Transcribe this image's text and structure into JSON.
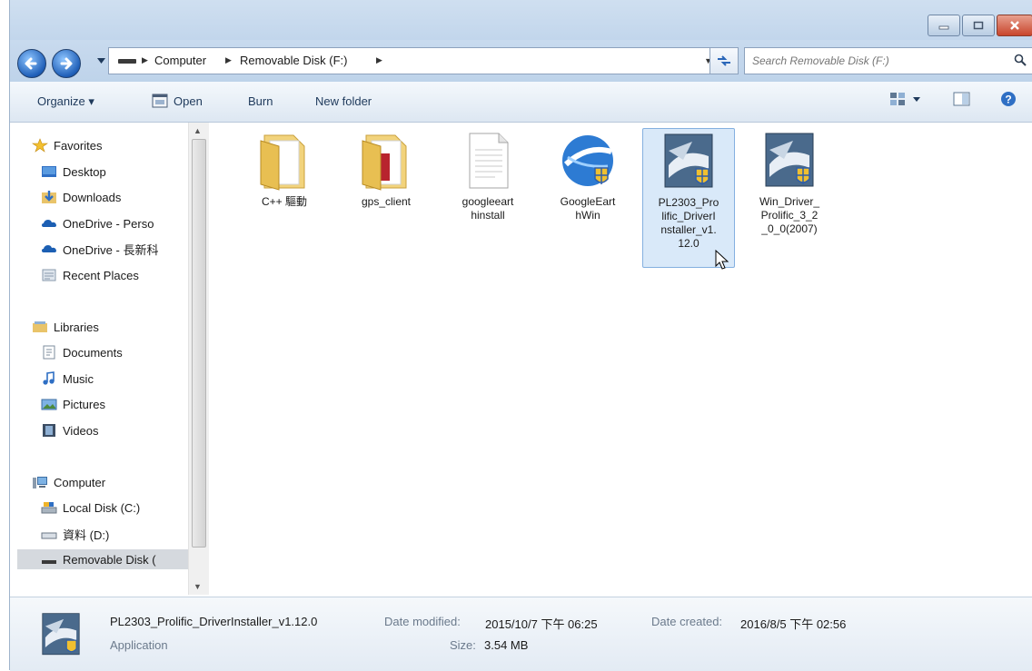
{
  "window": {
    "caption_buttons": [
      "minimize",
      "maximize",
      "close"
    ]
  },
  "address": {
    "crumbs": [
      "Computer",
      "Removable Disk (F:)"
    ],
    "search_placeholder": "Search Removable Disk (F:)"
  },
  "toolbar": {
    "organize": "Organize ▾",
    "open": "Open",
    "burn": "Burn",
    "new_folder": "New folder"
  },
  "nav": {
    "favorites": "Favorites",
    "desktop": "Desktop",
    "downloads": "Downloads",
    "onedrive1": "OneDrive - Perso",
    "onedrive2": "OneDrive - 長新科",
    "recent": "Recent Places",
    "libraries": "Libraries",
    "documents": "Documents",
    "music": "Music",
    "pictures": "Pictures",
    "videos": "Videos",
    "computer": "Computer",
    "local_disk": "Local Disk (C:)",
    "data_disk": "資料 (D:)",
    "removable": "Removable Disk ("
  },
  "files": [
    {
      "label": "C++ 驅動",
      "icon": "folder-icon"
    },
    {
      "label": "gps_client",
      "icon": "folder-icon"
    },
    {
      "label": "googleeart\nhinstall",
      "icon": "text-file-icon"
    },
    {
      "label": "GoogleEart\nhWin",
      "icon": "google-earth-icon"
    },
    {
      "label": "PL2303_Pro\nlific_DriverI\nnstaller_v1.\n12.0",
      "icon": "installer-icon"
    },
    {
      "label": "Win_Driver_\nProlific_3_2\n_0_0(2007)",
      "icon": "installer-icon"
    }
  ],
  "details": {
    "name": "PL2303_Prolific_DriverInstaller_v1.12.0",
    "type": "Application",
    "modified_label": "Date modified:",
    "modified_value": "2015/10/7 下午 06:25",
    "size_label": "Size:",
    "size_value": "3.54 MB",
    "created_label": "Date created:",
    "created_value": "2016/8/5 下午 02:56"
  },
  "colors": {
    "selection": "#d9e9f9",
    "selection_border": "#84b0e0",
    "titlebar": "#c8daee"
  }
}
